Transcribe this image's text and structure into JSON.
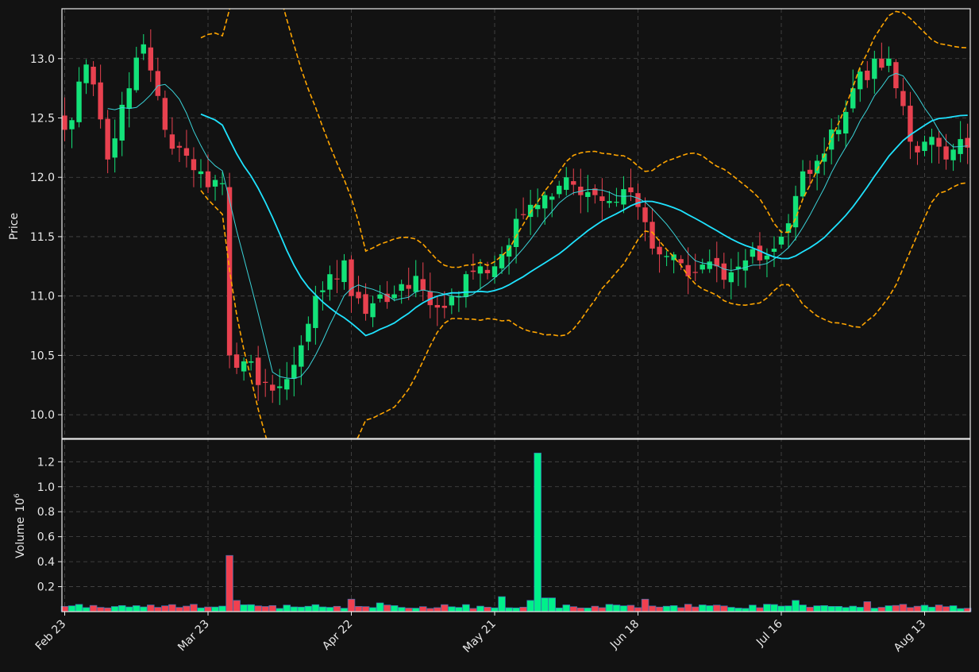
{
  "chart_data": {
    "type": "candlestick",
    "colors": {
      "background": "#121212",
      "up": "#13e279",
      "down": "#e8414f",
      "volume_up": "#00f08a",
      "volume_down": "#f0404f",
      "sma_slow": "#1fe3ff",
      "sma_fast": "#3ad3d8",
      "bands": "#ffa500",
      "grid": "#4a4a4a",
      "axis": "#e8e8e8"
    },
    "price_panel": {
      "ylabel": "Price",
      "ylim": [
        9.8,
        13.42
      ],
      "yticks": [
        "10.0",
        "10.5",
        "11.0",
        "11.5",
        "12.0",
        "12.5",
        "13.0"
      ],
      "ytick_values": [
        10.0,
        10.5,
        11.0,
        11.5,
        12.0,
        12.5,
        13.0
      ]
    },
    "volume_panel": {
      "ylabel": "Volume",
      "ylabel_exponent": "10",
      "ylabel_exponent_power": "6",
      "ylim": [
        0,
        1.38
      ],
      "yticks": [
        "0.2",
        "0.4",
        "0.6",
        "0.8",
        "1.0",
        "1.2"
      ],
      "ytick_values": [
        0.2,
        0.4,
        0.6,
        0.8,
        1.0,
        1.2
      ]
    },
    "xaxis": {
      "ticks": [
        "Feb 23",
        "Mar 23",
        "Apr 22",
        "May 21",
        "Jun 18",
        "Jul 16",
        "Aug 13"
      ],
      "tick_index": [
        0,
        20,
        40,
        60,
        80,
        100,
        120
      ],
      "n_bars": 127
    },
    "anchors": [
      [
        0,
        12.4
      ],
      [
        3,
        12.95
      ],
      [
        6,
        12.15
      ],
      [
        9,
        12.75
      ],
      [
        11,
        13.12
      ],
      [
        12,
        12.9
      ],
      [
        14,
        12.4
      ],
      [
        16,
        12.25
      ],
      [
        19,
        12.05
      ],
      [
        22,
        11.95
      ],
      [
        23,
        10.5
      ],
      [
        25,
        10.45
      ],
      [
        27,
        10.25
      ],
      [
        31,
        10.3
      ],
      [
        35,
        11.0
      ],
      [
        39,
        11.3
      ],
      [
        40,
        11.0
      ],
      [
        42,
        10.85
      ],
      [
        45,
        10.95
      ],
      [
        47,
        11.1
      ],
      [
        50,
        11.05
      ],
      [
        53,
        10.9
      ],
      [
        55,
        11.0
      ],
      [
        58,
        11.25
      ],
      [
        60,
        11.25
      ],
      [
        63,
        11.65
      ],
      [
        67,
        11.85
      ],
      [
        70,
        12.0
      ],
      [
        72,
        11.85
      ],
      [
        74,
        11.85
      ],
      [
        76,
        11.8
      ],
      [
        78,
        11.9
      ],
      [
        80,
        11.75
      ],
      [
        82,
        11.4
      ],
      [
        85,
        11.35
      ],
      [
        88,
        11.2
      ],
      [
        91,
        11.25
      ],
      [
        93,
        11.2
      ],
      [
        95,
        11.3
      ],
      [
        97,
        11.3
      ],
      [
        100,
        11.5
      ],
      [
        103,
        12.05
      ],
      [
        106,
        12.2
      ],
      [
        108,
        12.4
      ],
      [
        110,
        12.75
      ],
      [
        113,
        13.0
      ],
      [
        115,
        13.0
      ],
      [
        117,
        12.6
      ],
      [
        118,
        12.3
      ],
      [
        120,
        12.3
      ],
      [
        123,
        12.15
      ],
      [
        126,
        12.25
      ]
    ],
    "gaps": [
      [
        20,
        23,
        -1.6
      ],
      [
        64,
        68,
        -0.35
      ]
    ],
    "volume_baseline": 0.035,
    "volume_spikes": [
      [
        23,
        0.45
      ],
      [
        24,
        0.09
      ],
      [
        40,
        0.1
      ],
      [
        44,
        0.07
      ],
      [
        61,
        0.12
      ],
      [
        65,
        0.09
      ],
      [
        66,
        1.27
      ],
      [
        67,
        0.11
      ],
      [
        68,
        0.11
      ],
      [
        81,
        0.1
      ],
      [
        102,
        0.09
      ],
      [
        112,
        0.08
      ]
    ],
    "sma_fast_window": 7,
    "sma_slow_window": 20,
    "band_width": 2.0
  }
}
